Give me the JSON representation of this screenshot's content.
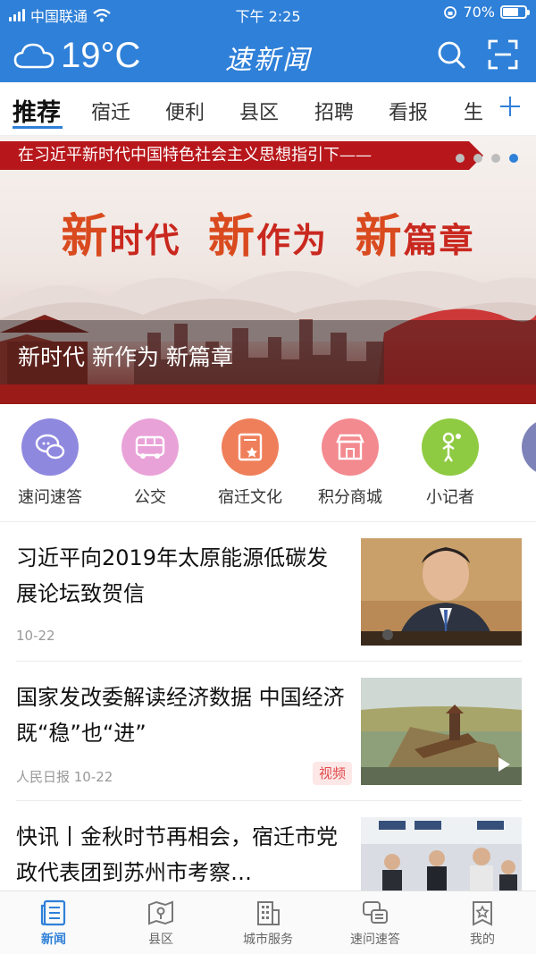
{
  "status_bar": {
    "carrier": "中国联通",
    "time": "下午 2:25",
    "battery": "70%",
    "battery_level": 0.7
  },
  "header": {
    "temperature": "19°C",
    "logo": "速新闻",
    "icons": [
      "cloud-icon",
      "search-icon",
      "scan-icon"
    ]
  },
  "tabs": [
    "推荐",
    "宿迁",
    "便利",
    "县区",
    "招聘",
    "看报",
    "生"
  ],
  "active_tab": 0,
  "banner": {
    "ribbon": "在习近平新时代中国特色社会主义思想指引下——",
    "slogan": {
      "c1": "新",
      "t1": "时代",
      "c2": "新",
      "t2": "作为",
      "c3": "新",
      "t3": "篇章"
    },
    "caption": "新时代 新作为 新篇章",
    "slide_count": 4,
    "active_slide": 4
  },
  "services": [
    {
      "label": "速问速答",
      "icon": "chat-bubbles-icon",
      "color": "#8f88df"
    },
    {
      "label": "公交",
      "icon": "bus-icon",
      "color": "#e9a2d8"
    },
    {
      "label": "宿迁文化",
      "icon": "book-star-icon",
      "color": "#ef7f5a"
    },
    {
      "label": "积分商城",
      "icon": "shop-icon",
      "color": "#f38a8f"
    },
    {
      "label": "小记者",
      "icon": "reporter-icon",
      "color": "#8ecb42"
    }
  ],
  "news": [
    {
      "title": "习近平向2019年太原能源低碳发展论坛致贺信",
      "meta": "10-22",
      "tag": ""
    },
    {
      "title": "国家发改委解读经济数据 中国经济既“稳”也“进”",
      "meta": "人民日报 10-22",
      "tag": "视频"
    },
    {
      "title": "快讯丨金秋时节再相会，宿迁市党政代表团到苏州市考察…",
      "meta": "",
      "tag": ""
    }
  ],
  "bottom_nav": [
    {
      "label": "新闻",
      "icon": "news-icon"
    },
    {
      "label": "县区",
      "icon": "map-icon"
    },
    {
      "label": "城市服务",
      "icon": "building-icon"
    },
    {
      "label": "速问速答",
      "icon": "qa-icon"
    },
    {
      "label": "我的",
      "icon": "profile-icon"
    }
  ],
  "colors": {
    "brand": "#2f80d8",
    "ribbon": "#b7171b",
    "tag_bg": "#fde7e7",
    "tag_text": "#e24b4b"
  }
}
